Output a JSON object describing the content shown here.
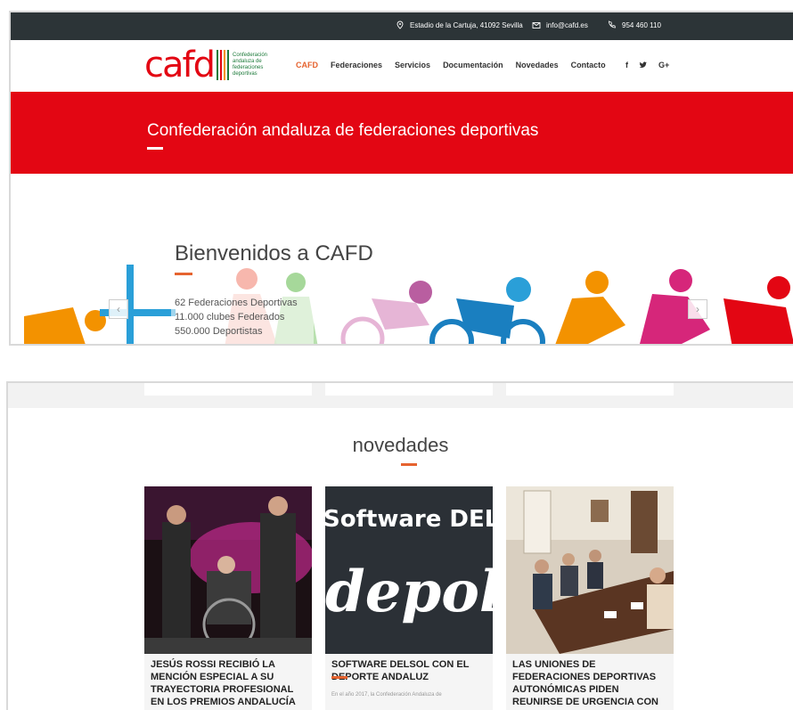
{
  "topbar": {
    "address": "Estadio de la Cartuja, 41092 Sevilla",
    "email": "info@cafd.es",
    "phone": "954 460 110"
  },
  "logo": {
    "word": "cafd",
    "subtitle_lines": [
      "Confederación",
      "andaluza de",
      "federaciones",
      "deportivas"
    ]
  },
  "nav": {
    "items": [
      "CAFD",
      "Federaciones",
      "Servicios",
      "Documentación",
      "Novedades",
      "Contacto"
    ],
    "social": [
      "f",
      "t-icon",
      "G+"
    ]
  },
  "banner": {
    "title": "Confederación andaluza de federaciones deportivas"
  },
  "hero": {
    "title": "Bienvenidos a CAFD",
    "stats": [
      "62 Federaciones Deportivas",
      "11.000 clubes Federados",
      "550.000 Deportistas"
    ]
  },
  "news": {
    "title": "novedades",
    "cards": [
      {
        "title": "JESÚS ROSSI RECIBIÓ LA MENCIÓN ESPECIAL A SU TRAYECTORIA PROFESIONAL EN LOS PREMIOS ANDALUCÍA",
        "excerpt": ""
      },
      {
        "title": "SOFTWARE DELSOL CON EL DEPORTE ANDALUZ",
        "image_text_top": "Software DEL",
        "image_text_bottom": "depol",
        "excerpt": "En el año 2017, la Confederación Andaluza de"
      },
      {
        "title": "LAS UNIONES DE FEDERACIONES DEPORTIVAS AUTONÓMICAS PIDEN REUNIRSE DE URGENCIA CON",
        "excerpt": ""
      }
    ]
  },
  "colors": {
    "brand_red": "#e30613",
    "accent_orange": "#e6632f",
    "topbar_dark": "#2c3437"
  }
}
